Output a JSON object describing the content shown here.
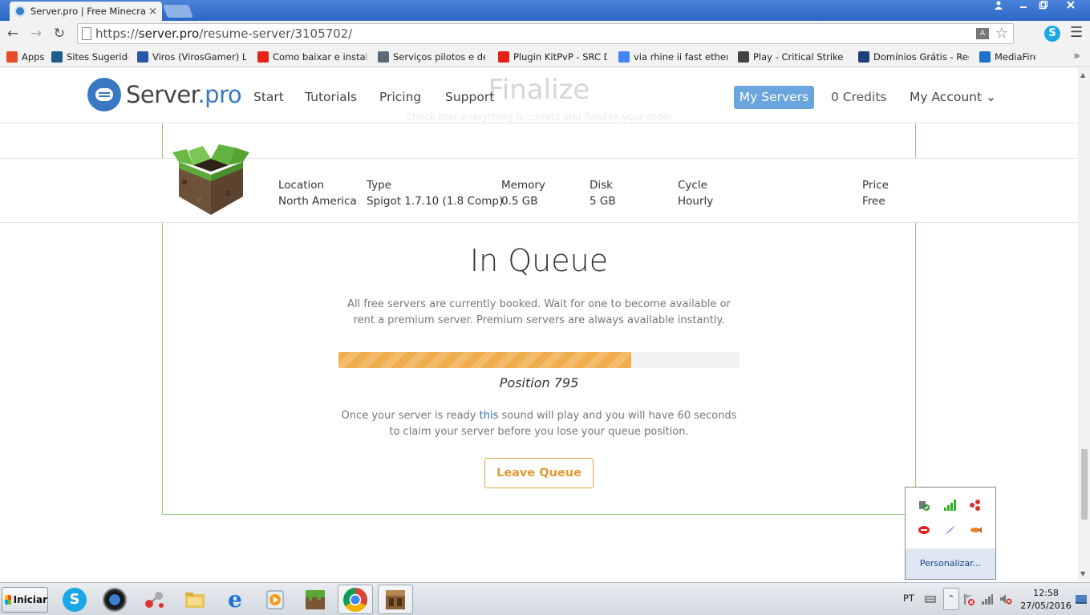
{
  "browser": {
    "tab_title": "Server.pro | Free Minecraft S",
    "tab_close": "×",
    "url_scheme": "https://",
    "url_domain": "server.pro",
    "url_path": "/resume-server/3105702/",
    "bookmarks": [
      {
        "label": "Apps",
        "icon": "apps-grid-icon",
        "color": "#e44d26"
      },
      {
        "label": "Sites Sugeridos",
        "icon": "bing-icon",
        "color": "#1b5e8a"
      },
      {
        "label": "Viros (VirosGamer) Live S",
        "icon": "lc-icon",
        "color": "#2a55a8"
      },
      {
        "label": "Como baixar e instalar o",
        "icon": "youtube-icon",
        "color": "#e62117"
      },
      {
        "label": "Serviços pilotos e de dia",
        "icon": "shield-icon",
        "color": "#5a6a7a"
      },
      {
        "label": "Plugin KitPvP - SRC Dow",
        "icon": "youtube-icon",
        "color": "#e62117"
      },
      {
        "label": "via rhine ii fast ethernet",
        "icon": "google-icon",
        "color": "#4285f4"
      },
      {
        "label": "Play - Critical Strike Port",
        "icon": "radiation-icon",
        "color": "#444444"
      },
      {
        "label": "Domínios Grátis - Registr",
        "icon": "s-icon",
        "color": "#1d3f7a"
      },
      {
        "label": "MediaFire",
        "icon": "mediafire-icon",
        "color": "#1a73c9"
      }
    ]
  },
  "site": {
    "logo_main": "Server",
    "logo_suffix": ".pro",
    "nav": [
      "Start",
      "Tutorials",
      "Pricing",
      "Support"
    ],
    "my_servers": "My Servers",
    "credits": "0 Credits",
    "account": "My Account ⌄",
    "ghost_title": "Finalize",
    "ghost_subtitle": "Check that everything is correct and finalize your order"
  },
  "order": {
    "specs": [
      {
        "label": "Location",
        "value": "North America"
      },
      {
        "label": "Type",
        "value": "Spigot 1.7.10 (1.8 Comp)"
      },
      {
        "label": "Memory",
        "value": "0.5 GB"
      },
      {
        "label": "Disk",
        "value": "5 GB"
      },
      {
        "label": "Cycle",
        "value": "Hourly"
      },
      {
        "label": "Price",
        "value": "Free"
      }
    ]
  },
  "queue": {
    "title": "In Queue",
    "description": "All free servers are currently booked. Wait for one to become available or rent a premium server. Premium servers are always available instantly.",
    "progress_percent": 73,
    "position_text": "Position 795",
    "claim_before": "Once your server is ready ",
    "claim_link": "this",
    "claim_after": " sound will play and you will have 60 seconds to claim your server before you lose your queue position.",
    "leave_button": "Leave Queue"
  },
  "tray_popup": {
    "customize": "Personalizar..."
  },
  "taskbar": {
    "start_label": "Iniciar",
    "language": "PT",
    "time": "12:58",
    "date": "27/05/2016"
  },
  "colors": {
    "brand_blue": "#3a78c3",
    "card_border": "#8cc77a",
    "progress_orange": "#f0ad4e",
    "leave_button": "#e09a33"
  }
}
